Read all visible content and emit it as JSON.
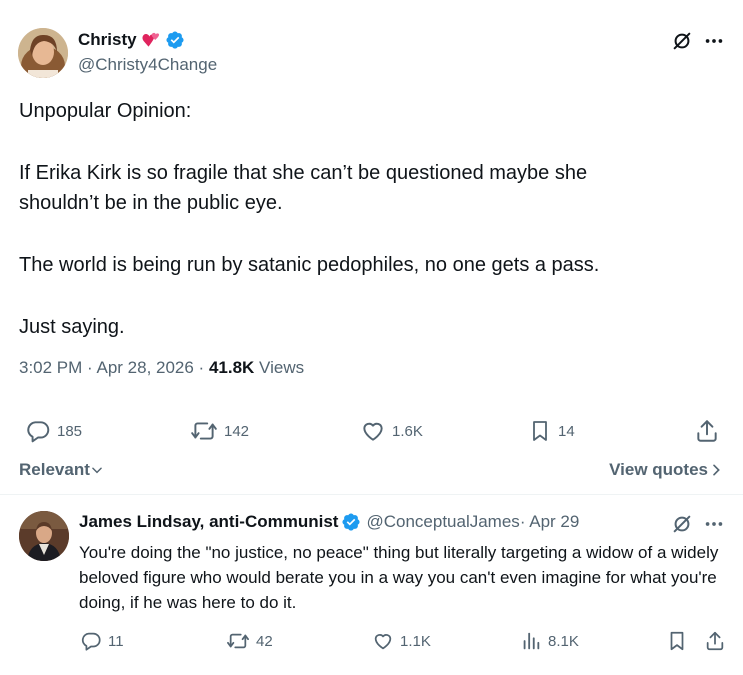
{
  "tweet": {
    "author_name": "Christy",
    "author_handle": "@Christy4Change",
    "emoji_heart": "heart-emoji",
    "lines": [
      "Unpopular Opinion:",
      "If Erika Kirk is so fragile that she can’t be questioned maybe she",
      "shouldn’t be in the public eye.",
      "The world is being run by satanic pedophiles, no one gets a pass.",
      "Just saying."
    ],
    "time": "3:02 PM · Apr 28, 2026 · ",
    "views_count": "41.8K",
    "views_label": " Views",
    "stats": {
      "replies": "185",
      "reposts": "142",
      "likes": "1.6K",
      "bookmarks": "14"
    }
  },
  "filters": {
    "sort_label": "Relevant",
    "view_quotes_label": "View quotes"
  },
  "reply": {
    "author_name": "James Lindsay, anti-Communist",
    "author_handle": "@ConceptualJames",
    "date": " · Apr 29",
    "text": "You're doing the \"no justice, no peace\" thing but literally targeting a widow of a widely beloved figure who would berate you in a way you can't even imagine for what you're doing, if he was here to do it.",
    "stats": {
      "replies": "11",
      "reposts": "42",
      "likes": "1.1K",
      "views": "8.1K"
    }
  },
  "colors": {
    "verified": "#1d9bf0",
    "muted": "#536471",
    "text": "#0f1419",
    "divider": "#eff3f4"
  }
}
